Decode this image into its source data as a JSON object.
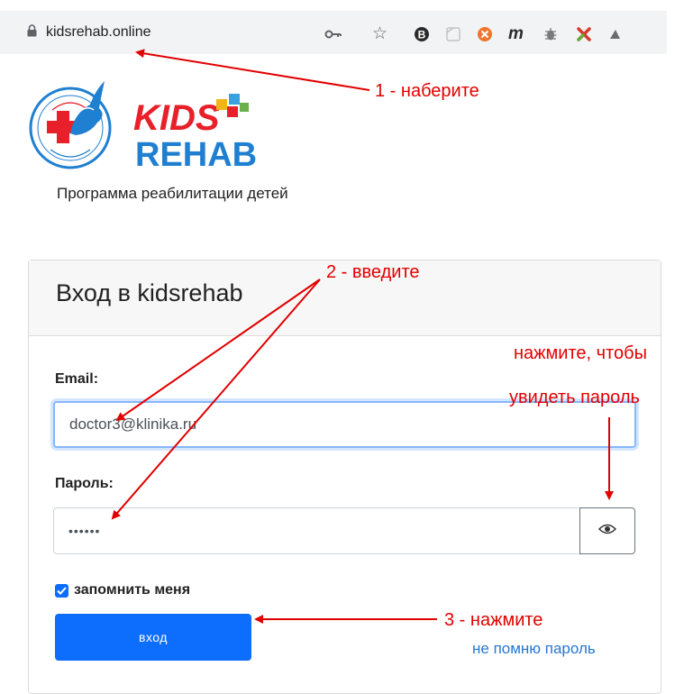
{
  "browser": {
    "url": "kidsrehab.online",
    "icons": [
      "lock-icon",
      "key-icon",
      "star-icon",
      "extension-icons"
    ]
  },
  "logo": {
    "word_top": "KIDS",
    "word_bottom": "REHAB",
    "seal_text": "Помощь детям с тяжёлой травмой и их последствиями · Фонд Детского Доктора Рошаля"
  },
  "tagline": "Программа реабилитации детей",
  "login_card": {
    "title": "Вход в kidsrehab",
    "email_label": "Email:",
    "email_value": "doctor3@klinika.ru",
    "password_label": "Пароль:",
    "password_value": "••••••",
    "show_password_icon": "eye-icon",
    "remember_label": "запомнить меня",
    "remember_checked": true,
    "submit_label": "вход",
    "forgot_link": "не помню пароль"
  },
  "annotations": {
    "step1": "1 - наберите",
    "step2": "2 - введите",
    "step3": "3 - нажмите",
    "eye_hint_line1": "нажмите, чтобы",
    "eye_hint_line2": "увидеть пароль"
  },
  "colors": {
    "annotation": "#e10000",
    "primary": "#0d6efd",
    "link": "#2478d3",
    "logo_red": "#e8202a",
    "logo_blue": "#1f7fd0"
  }
}
